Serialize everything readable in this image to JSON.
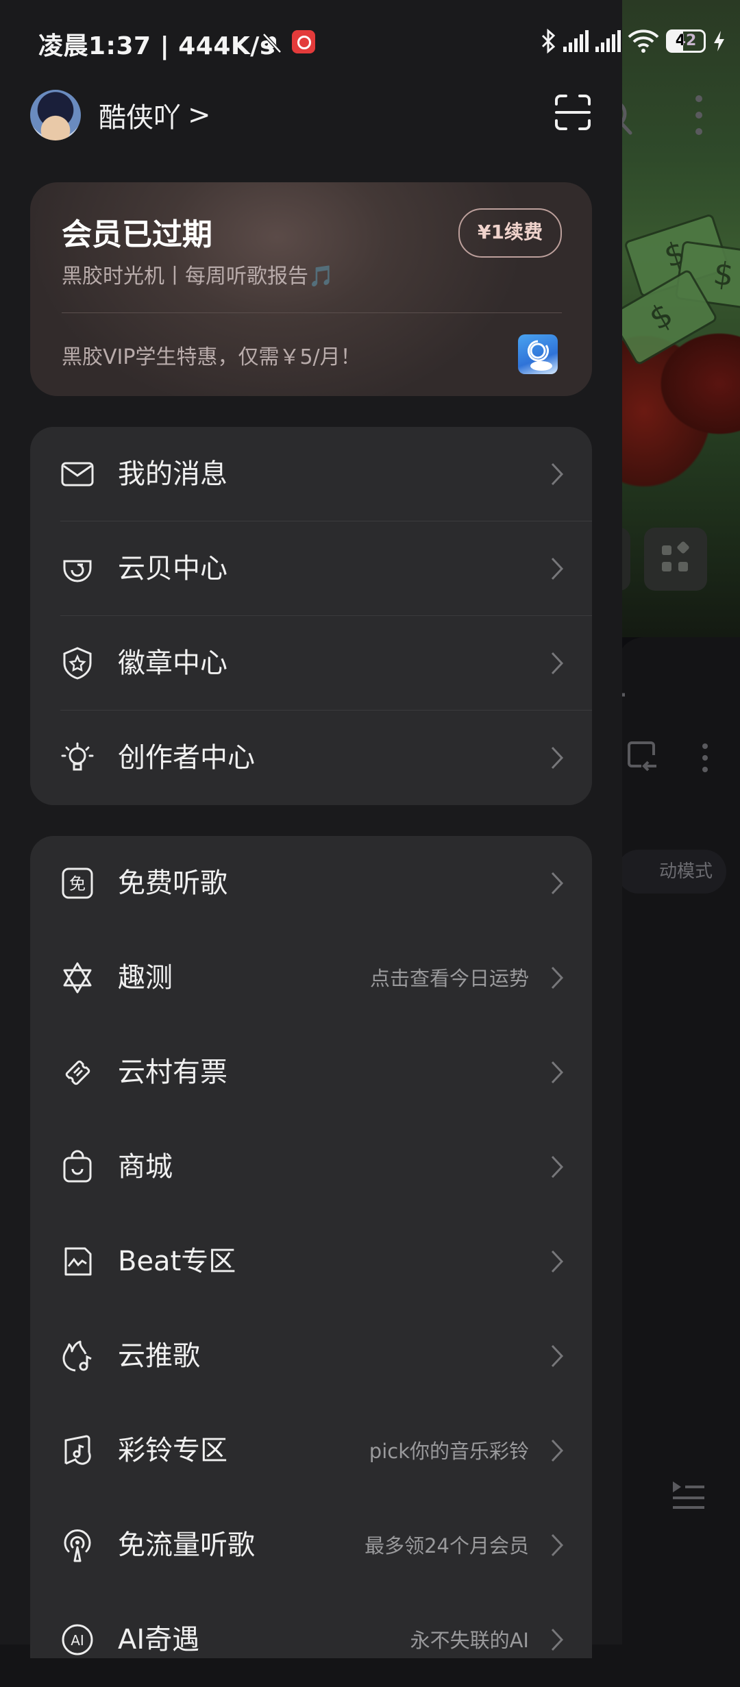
{
  "status_bar": {
    "time": "凌晨1:37 | 444K/s",
    "battery": "42"
  },
  "profile": {
    "username": "酷侠吖",
    "chevron": ">"
  },
  "vip_card": {
    "title": "会员已过期",
    "subtitle": "黑胶时光机丨每周听歌报告🎵",
    "renew_button": "¥1续费",
    "promo": "黑胶VIP学生特惠，仅需￥5/月！"
  },
  "menu_group_1": [
    {
      "label": "我的消息",
      "icon": "mail-icon"
    },
    {
      "label": "云贝中心",
      "icon": "yunbei-icon"
    },
    {
      "label": "徽章中心",
      "icon": "badge-icon"
    },
    {
      "label": "创作者中心",
      "icon": "lightbulb-icon"
    }
  ],
  "menu_group_2": [
    {
      "label": "免费听歌",
      "hint": "",
      "icon": "free-icon"
    },
    {
      "label": "趣测",
      "hint": "点击查看今日运势",
      "icon": "star-of-david-icon"
    },
    {
      "label": "云村有票",
      "hint": "",
      "icon": "ticket-icon"
    },
    {
      "label": "商城",
      "hint": "",
      "icon": "shopping-bag-icon"
    },
    {
      "label": "Beat专区",
      "hint": "",
      "icon": "beat-icon"
    },
    {
      "label": "云推歌",
      "hint": "",
      "icon": "flame-note-icon"
    },
    {
      "label": "彩铃专区",
      "hint": "pick你的音乐彩铃",
      "icon": "ringtone-icon"
    },
    {
      "label": "免流量听歌",
      "hint": "最多领24个月会员",
      "icon": "podcast-icon"
    },
    {
      "label": "AI奇遇",
      "hint": "永不失联的AI",
      "icon": "ai-icon"
    }
  ],
  "background_app": {
    "mode_chip": "动模式"
  }
}
